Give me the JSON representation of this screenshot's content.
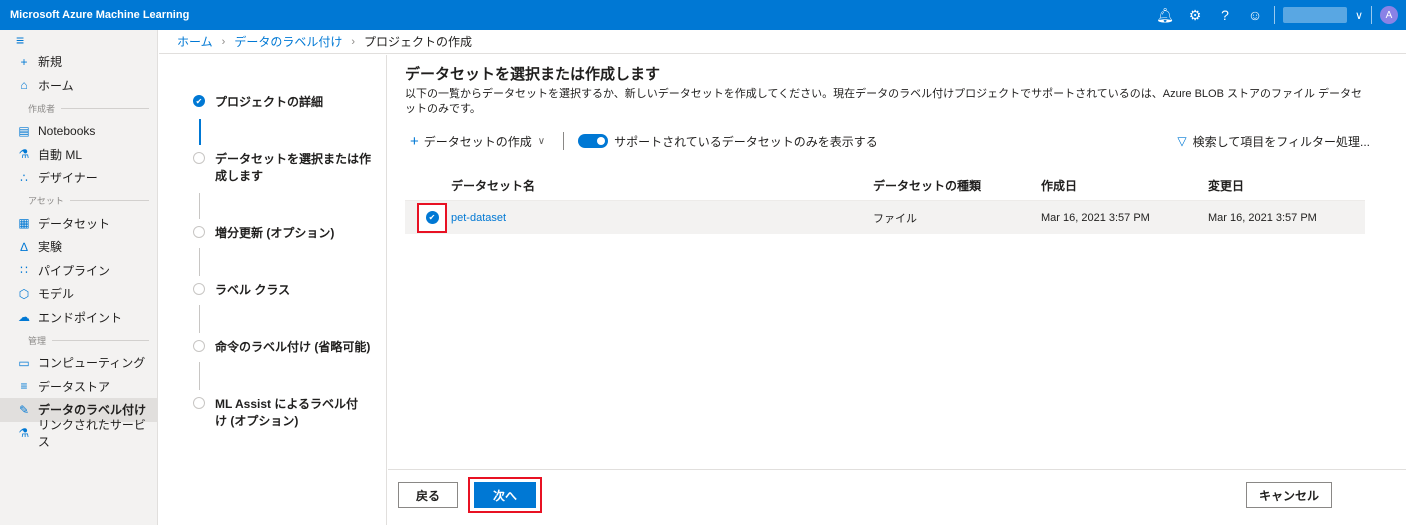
{
  "app": {
    "title": "Microsoft Azure Machine Learning"
  },
  "topbar": {
    "icons": [
      "bell-icon",
      "gear-icon",
      "help-icon",
      "smiley-icon"
    ],
    "avatar_initial": "A"
  },
  "nav": {
    "new": "新規",
    "home": "ホーム",
    "section_author": "作成者",
    "notebooks": "Notebooks",
    "automl": "自動 ML",
    "designer": "デザイナー",
    "section_assets": "アセット",
    "datasets": "データセット",
    "experiments": "実験",
    "pipelines": "パイプライン",
    "models": "モデル",
    "endpoints": "エンドポイント",
    "section_manage": "管理",
    "compute": "コンピューティング",
    "datastores": "データストア",
    "data_labeling": "データのラベル付け",
    "linked_services": "リンクされたサービス"
  },
  "breadcrumb": {
    "home": "ホーム",
    "labeling": "データのラベル付け",
    "current": "プロジェクトの作成"
  },
  "steps": [
    {
      "label": "プロジェクトの詳細",
      "done": true
    },
    {
      "label": "データセットを選択または作成します",
      "done": false
    },
    {
      "label": "増分更新 (オプション)",
      "done": false
    },
    {
      "label": "ラベル クラス",
      "done": false
    },
    {
      "label": "命令のラベル付け (省略可能)",
      "done": false
    },
    {
      "label": "ML Assist によるラベル付け (オプション)",
      "done": false
    }
  ],
  "main": {
    "title": "データセットを選択または作成します",
    "description": "以下の一覧からデータセットを選択するか、新しいデータセットを作成してください。現在データのラベル付けプロジェクトでサポートされているのは、Azure BLOB ストアのファイル データセットのみです。",
    "create_dataset": "データセットの作成",
    "toggle_label": "サポートされているデータセットのみを表示する",
    "filter_placeholder": "検索して項目をフィルター処理..."
  },
  "table": {
    "headers": {
      "name": "データセット名",
      "type": "データセットの種類",
      "created": "作成日",
      "modified": "変更日"
    },
    "rows": [
      {
        "name": "pet-dataset",
        "type": "ファイル",
        "created": "Mar 16, 2021 3:57 PM",
        "modified": "Mar 16, 2021 3:57 PM",
        "selected": true
      }
    ]
  },
  "footer": {
    "back": "戻る",
    "next": "次へ",
    "cancel": "キャンセル"
  },
  "colors": {
    "accent": "#0078d4",
    "highlight": "#e81123"
  }
}
